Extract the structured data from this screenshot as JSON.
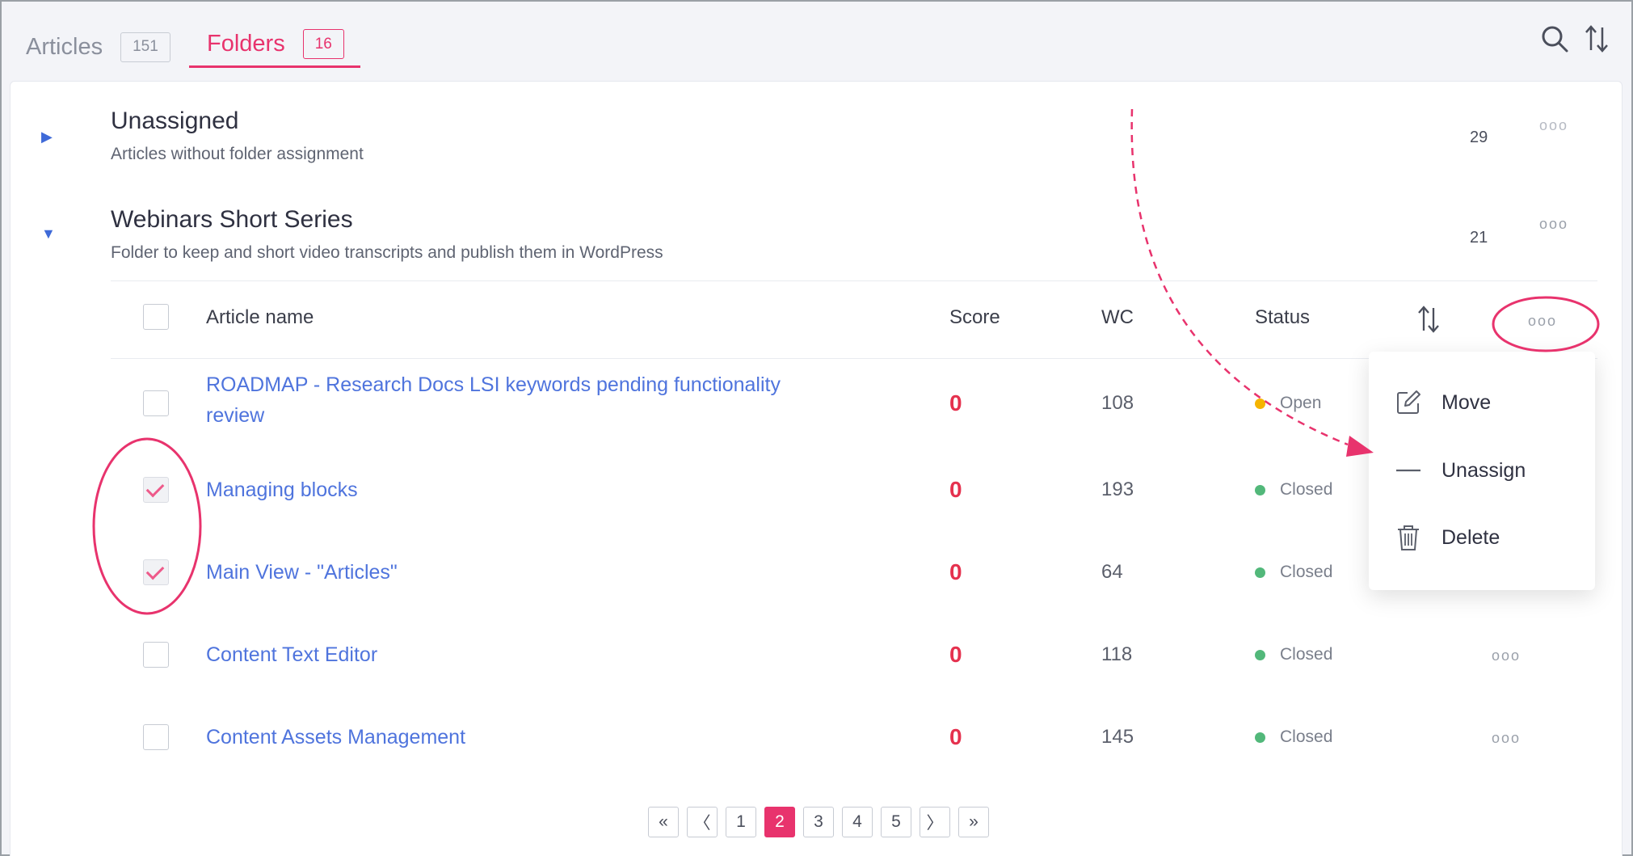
{
  "tabs": [
    {
      "label": "Articles",
      "count": "151"
    },
    {
      "label": "Folders",
      "count": "16"
    }
  ],
  "header_icons": {
    "search": "search-icon",
    "sort": "sort-icon"
  },
  "folders": [
    {
      "title": "Unassigned",
      "description": "Articles without folder assignment",
      "count": "29",
      "expanded": false
    },
    {
      "title": "Webinars Short Series",
      "description": "Folder to keep and short video transcripts and publish them in WordPress",
      "count": "21",
      "expanded": true
    }
  ],
  "table": {
    "headers": {
      "name": "Article name",
      "score": "Score",
      "wc": "WC",
      "status": "Status"
    },
    "rows": [
      {
        "name": "ROADMAP - Research Docs LSI keywords pending functionality review",
        "score": "0",
        "wc": "108",
        "status": "Open",
        "status_color": "#f5b400",
        "checked": false
      },
      {
        "name": "Managing blocks",
        "score": "0",
        "wc": "193",
        "status": "Closed",
        "status_color": "#52b87a",
        "checked": true
      },
      {
        "name": "Main View - \"Articles\"",
        "score": "0",
        "wc": "64",
        "status": "Closed",
        "status_color": "#52b87a",
        "checked": true
      },
      {
        "name": "Content Text Editor",
        "score": "0",
        "wc": "118",
        "status": "Closed",
        "status_color": "#52b87a",
        "checked": false
      },
      {
        "name": "Content Assets Management",
        "score": "0",
        "wc": "145",
        "status": "Closed",
        "status_color": "#52b87a",
        "checked": false
      }
    ]
  },
  "menu": {
    "items": [
      {
        "label": "Move",
        "icon": "edit-icon"
      },
      {
        "label": "Unassign",
        "icon": "minus-icon"
      },
      {
        "label": "Delete",
        "icon": "trash-icon"
      }
    ]
  },
  "pagination": {
    "first": "«",
    "prev": "〈",
    "next": "〉",
    "last": "»",
    "pages": [
      "1",
      "2",
      "3",
      "4",
      "5"
    ],
    "current": "2"
  },
  "colors": {
    "accent": "#e8336d",
    "link": "#4f74dd",
    "score": "#e5314e",
    "annotation": "#e8336d"
  }
}
